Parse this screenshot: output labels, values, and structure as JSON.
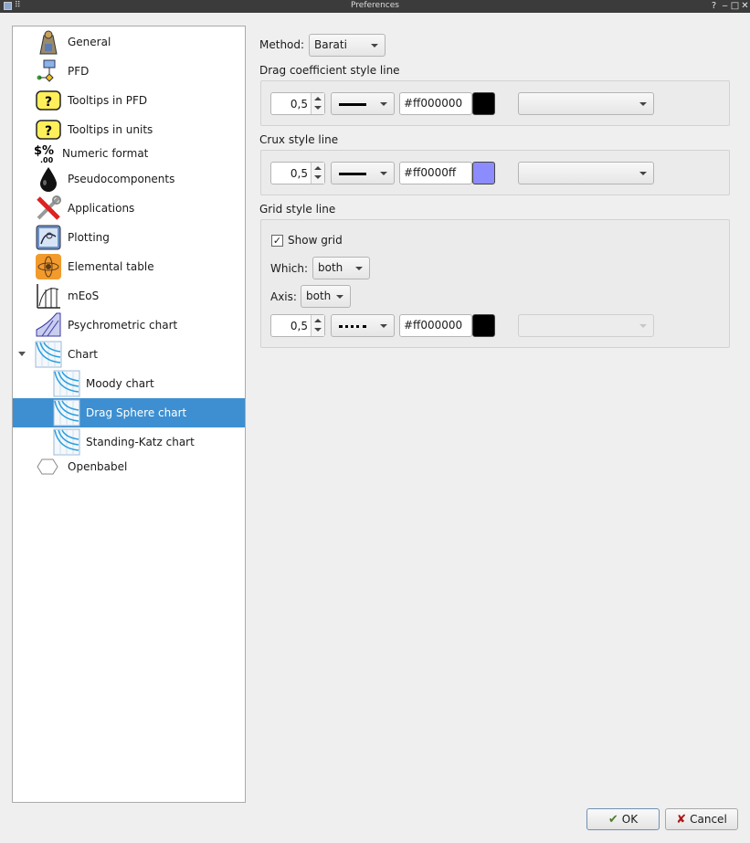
{
  "window": {
    "title": "Preferences"
  },
  "sidebar": {
    "items": [
      {
        "label": "General"
      },
      {
        "label": "PFD"
      },
      {
        "label": "Tooltips in PFD"
      },
      {
        "label": "Tooltips in units"
      },
      {
        "label": "Numeric format"
      },
      {
        "label": "Pseudocomponents"
      },
      {
        "label": "Applications"
      },
      {
        "label": "Plotting"
      },
      {
        "label": "Elemental table"
      },
      {
        "label": "mEoS"
      },
      {
        "label": "Psychrometric chart"
      },
      {
        "label": "Chart"
      },
      {
        "label": "Moody chart"
      },
      {
        "label": "Drag Sphere chart"
      },
      {
        "label": "Standing-Katz chart"
      },
      {
        "label": "Openbabel"
      }
    ],
    "selected": "Drag Sphere chart"
  },
  "method": {
    "label": "Method:",
    "value": "Barati"
  },
  "drag_line": {
    "title": "Drag coefficient style line",
    "width": "0,5",
    "color_text": "#ff000000",
    "color": "#000000",
    "marker": ""
  },
  "crux_line": {
    "title": "Crux style line",
    "width": "0,5",
    "color_text": "#ff0000ff",
    "color": "#8c8cff",
    "marker": ""
  },
  "grid_line": {
    "title": "Grid style line",
    "show_grid_label": "Show grid",
    "show_grid_checked": "✓",
    "which_label": "Which:",
    "which_value": "both",
    "axis_label": "Axis:",
    "axis_value": "both",
    "width": "0,5",
    "color_text": "#ff000000",
    "color": "#000000",
    "marker": ""
  },
  "buttons": {
    "ok": "OK",
    "cancel": "Cancel"
  }
}
